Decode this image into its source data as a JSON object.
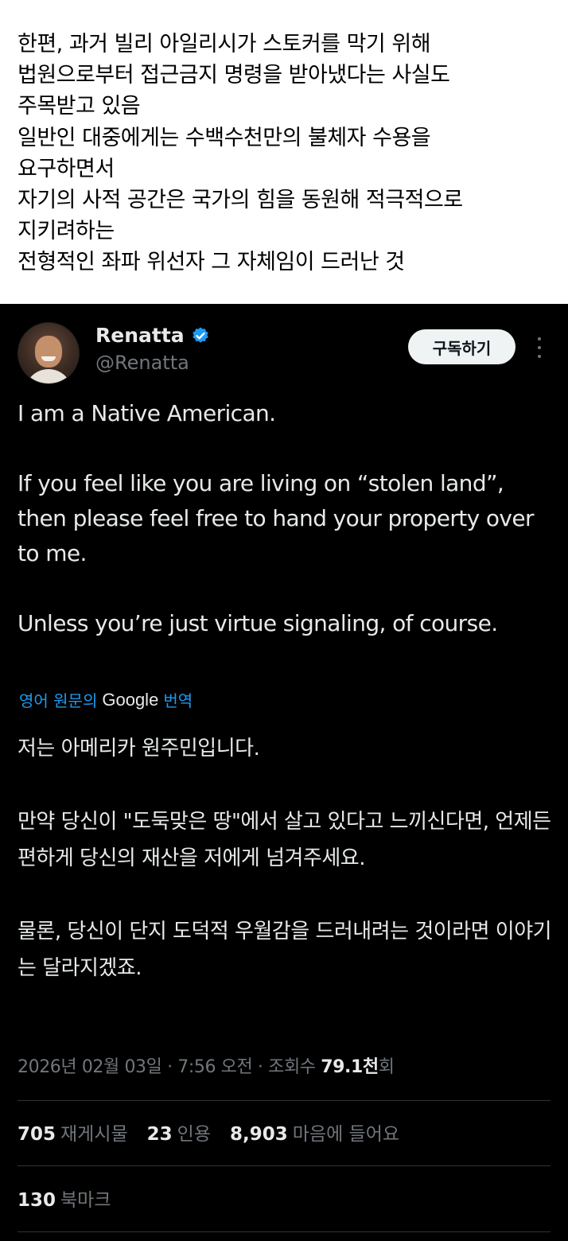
{
  "caption": {
    "lines": [
      "한편, 과거 빌리 아일리시가 스토커를 막기 위해",
      "법원으로부터 접근금지 명령을 받아냈다는 사실도",
      "주목받고 있음",
      "일반인 대중에게는 수백수천만의 불체자 수용을",
      "요구하면서",
      "자기의 사적 공간은 국가의 힘을 동원해 적극적으로",
      "지키려하는",
      "전형적인 좌파 위선자 그 자체임이 드러난 것"
    ]
  },
  "tweet": {
    "author_name": "Renatta",
    "handle": "@Renatta",
    "verified_icon": "verified-badge-icon",
    "verified_color": "#1d9bf0",
    "subscribe_label": "구독하기",
    "body_en": [
      "I am a Native American.",
      "If you feel like you are living on “stolen land”, then please feel free to hand your property over to me.",
      "Unless you’re just virtue signaling, of course."
    ],
    "translation": {
      "prefix": "영어 원문의",
      "provider": "Google",
      "suffix": "번역"
    },
    "body_ko": [
      "저는 아메리카 원주민입니다.",
      "만약 당신이 \"도둑맞은 땅\"에서 살고 있다고 느끼신다면, 언제든 편하게 당신의 재산을 저에게 넘겨주세요.",
      "물론, 당신이 단지 도덕적 우월감을 드러내려는 것이라면 이야기는 달라지겠죠."
    ],
    "meta": {
      "datetime": "2026년 02월 03일 · 7:56 오전 · 조회수 ",
      "views": "79.1천",
      "views_suffix": "회"
    },
    "stats": {
      "reposts": "705",
      "reposts_label": "재게시물",
      "quotes": "23",
      "quotes_label": "인용",
      "likes": "8,903",
      "likes_label": "마음에 들어요",
      "bookmarks": "130",
      "bookmarks_label": "북마크"
    },
    "colors": {
      "background": "#000000",
      "text": "#e7e9ea",
      "muted": "#71767b",
      "link": "#1d9bf0",
      "divider": "#2f3336"
    }
  }
}
